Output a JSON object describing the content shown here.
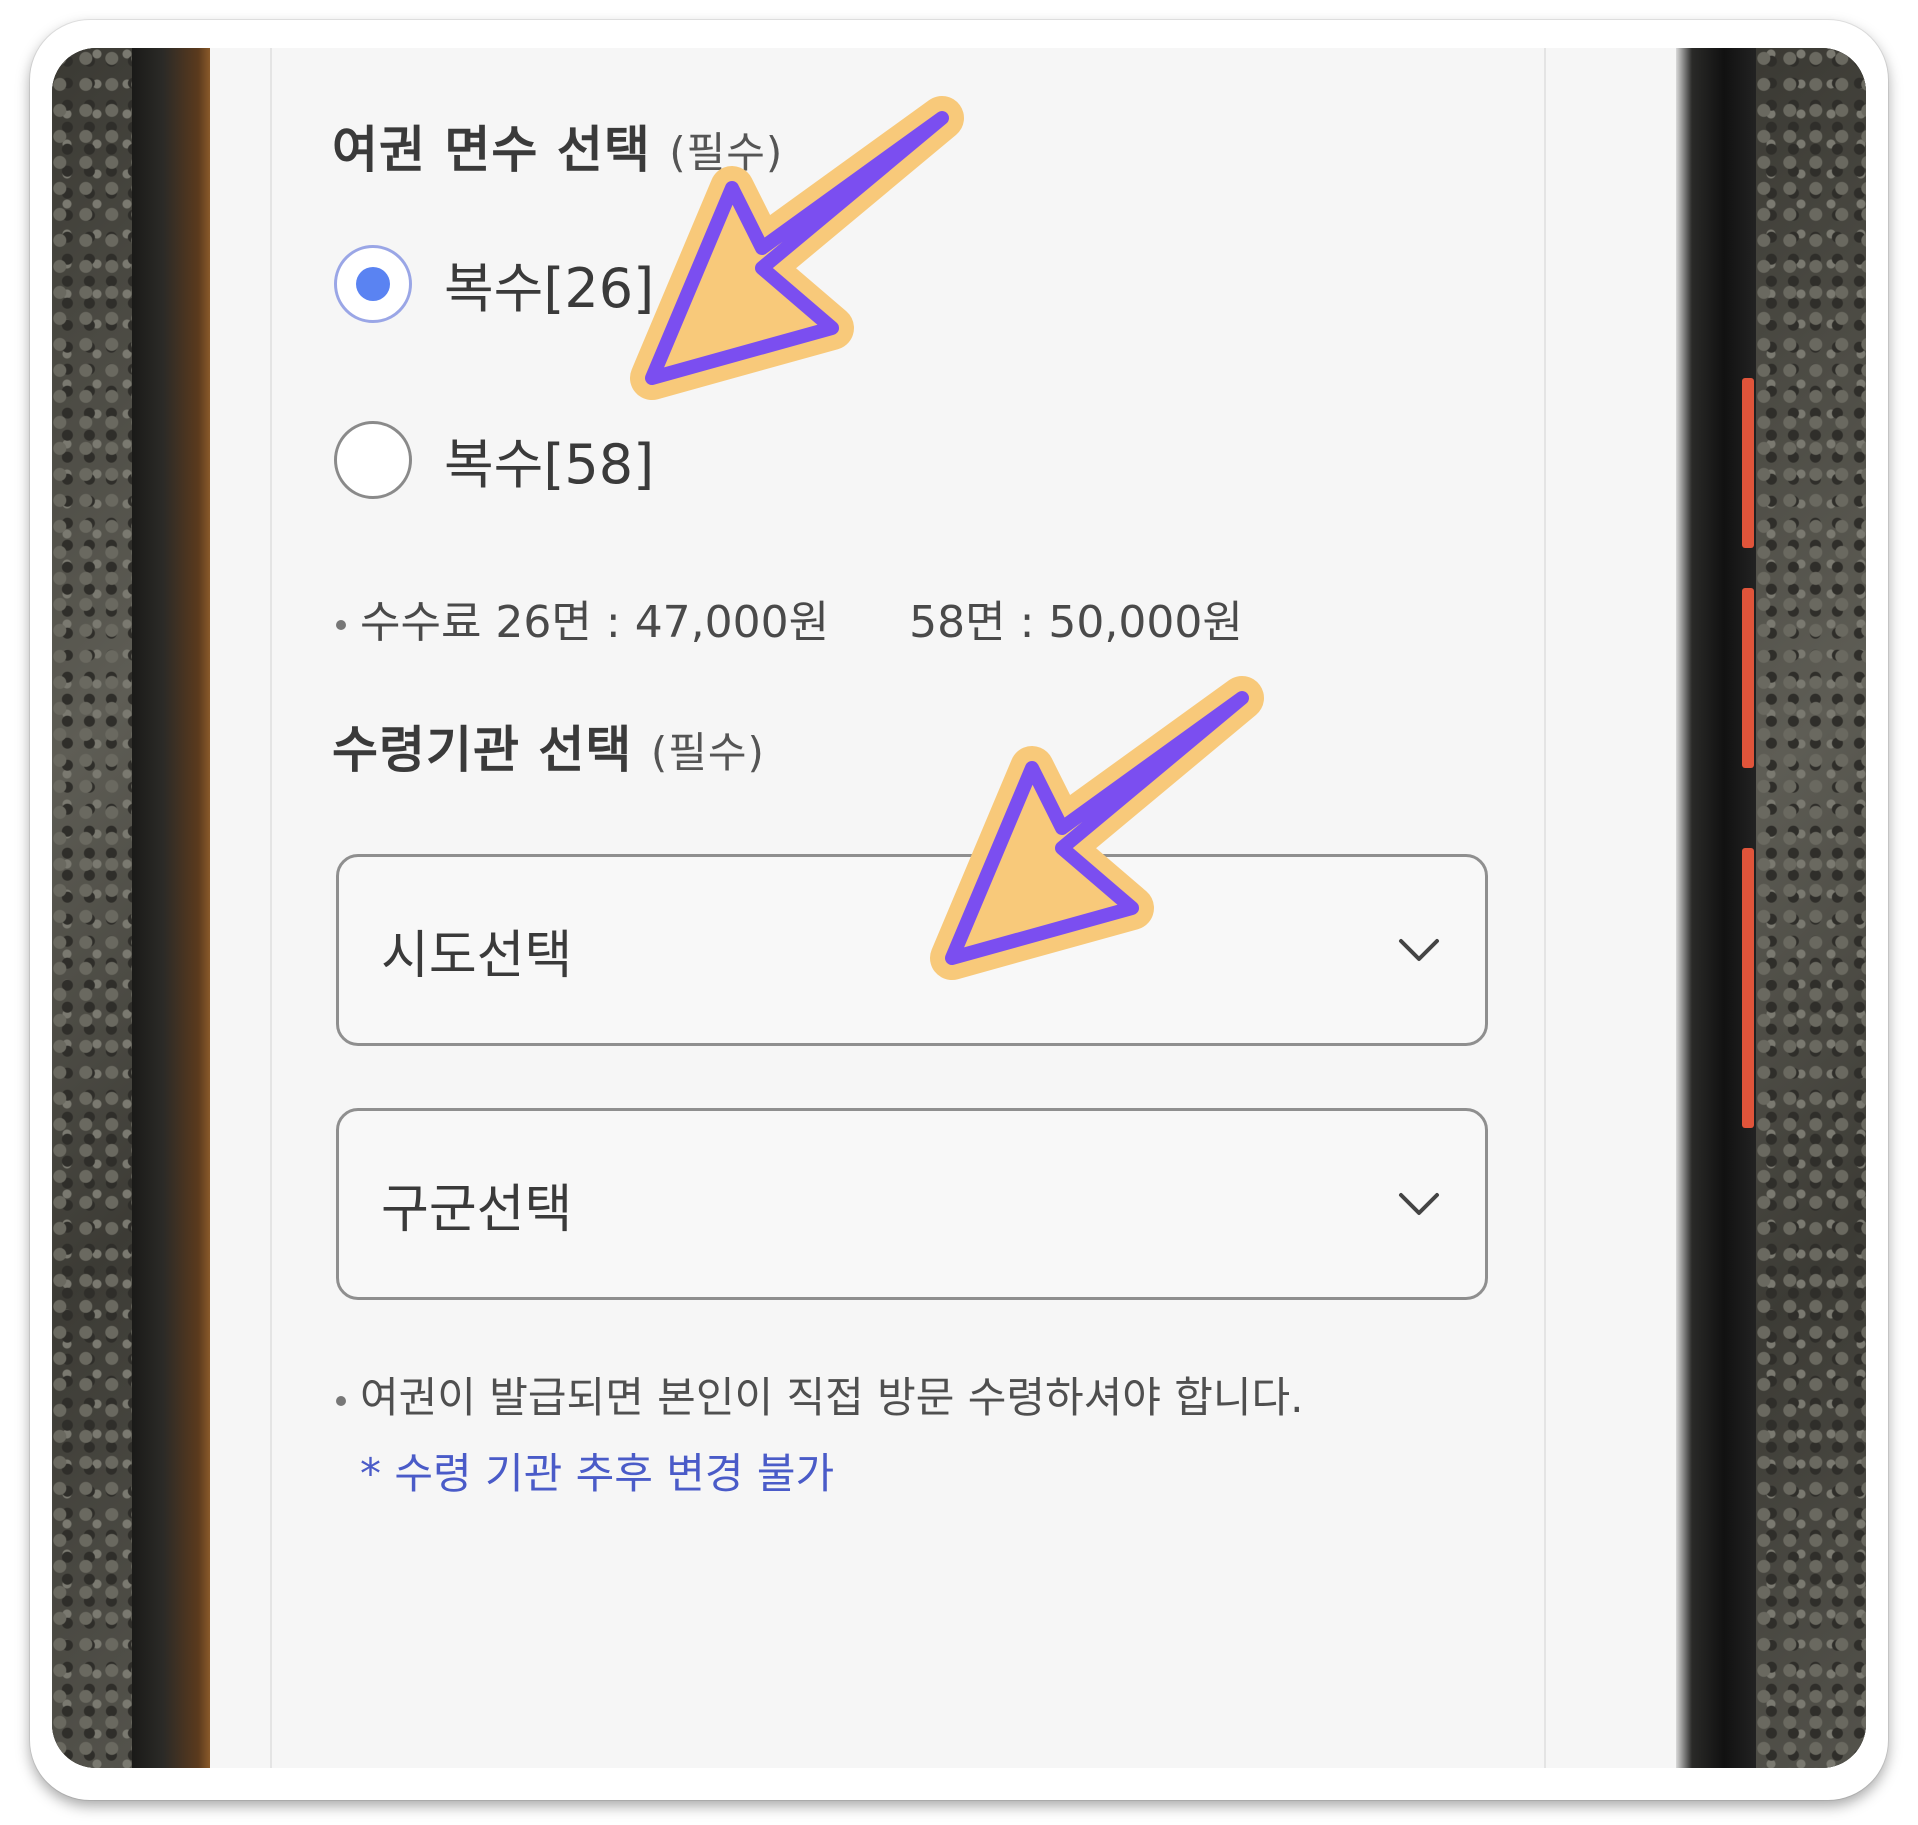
{
  "passport_pages": {
    "title": "여권 면수 선택",
    "required": "(필수)",
    "options": [
      {
        "label": "복수[26]",
        "checked": true
      },
      {
        "label": "복수[58]",
        "checked": false
      }
    ],
    "fee_26": "수수료 26면 : 47,000원",
    "fee_58": "58면 : 50,000원"
  },
  "pickup_office": {
    "title": "수령기관 선택",
    "required": "(필수)",
    "province_select": "시도선택",
    "district_select": "구군선택",
    "notice": "여권이 발급되면 본인이 직접 방문 수령하셔야 합니다.",
    "note": "* 수령 기관 추후 변경 불가"
  },
  "icons": {
    "chevron": "chevron-down-icon",
    "annotation_arrow": "arrow-annotation-icon"
  },
  "colors": {
    "accent_radio": "#5a83f2",
    "arrow_fill": "#f8c97a",
    "arrow_stroke": "#7b4ef0",
    "note_blue": "#4a5bc8"
  }
}
